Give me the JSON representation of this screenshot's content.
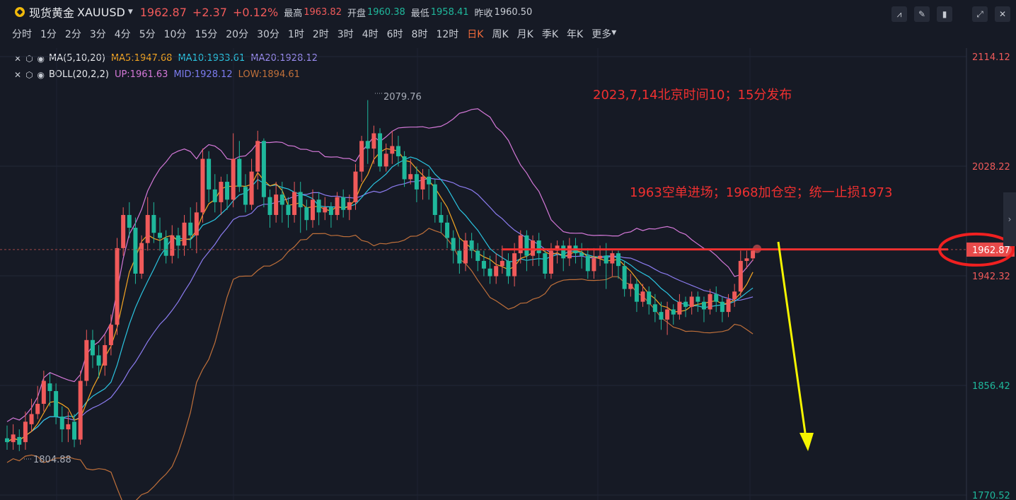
{
  "header": {
    "instrument": "现货黄金",
    "symbol": "XAUUSD",
    "last": "1962.87",
    "change": "+2.37",
    "change_pct": "+0.12%",
    "high_label": "最高",
    "high": "1963.82",
    "open_label": "开盘",
    "open": "1960.38",
    "low_label": "最低",
    "low": "1958.41",
    "prev_close_label": "昨收",
    "prev_close": "1960.50"
  },
  "periods": [
    "分时",
    "1分",
    "2分",
    "3分",
    "4分",
    "5分",
    "10分",
    "15分",
    "20分",
    "30分",
    "1时",
    "2时",
    "3时",
    "4时",
    "6时",
    "8时",
    "12时",
    "日K",
    "周K",
    "月K",
    "季K",
    "年K",
    "更多"
  ],
  "active_period": "日K",
  "indicators": {
    "ma": {
      "name": "MA(5,10,20)",
      "ma5": "MA5:1947.68",
      "ma10": "MA10:1933.61",
      "ma20": "MA20:1928.12"
    },
    "boll": {
      "name": "BOLL(20,2,2)",
      "up": "UP:1961.63",
      "mid": "MID:1928.12",
      "low": "LOW:1894.61"
    }
  },
  "annotations": {
    "note1": "2023,7,14北京时间10；15分发布",
    "note2": "1963空单进场；1968加仓空；统一止损1973",
    "max_label": "2079.76",
    "min_label": "1804.88"
  },
  "colors": {
    "up": "#f05a5a",
    "down": "#1fb89c",
    "ma5": "#f5a623",
    "ma10": "#2bc4e0",
    "ma20": "#8c7cf0",
    "boll_up": "#d478d8",
    "boll_low": "#c0703a",
    "annotation": "#f03030",
    "arrow": "#f5f500"
  },
  "chart_data": {
    "type": "candlestick",
    "y_axis_labels": [
      "2114.12",
      "2028.22",
      "1942.32",
      "1856.42",
      "1770.52"
    ],
    "ylim": [
      1770.52,
      2114.12
    ],
    "price_tag": "1962.87",
    "entry_level": 1963,
    "candles": [
      [
        1815,
        1812,
        1825,
        1806
      ],
      [
        1812,
        1818,
        1826,
        1806
      ],
      [
        1816,
        1810,
        1822,
        1805
      ],
      [
        1812,
        1828,
        1836,
        1806
      ],
      [
        1826,
        1834,
        1846,
        1820
      ],
      [
        1834,
        1842,
        1856,
        1830
      ],
      [
        1842,
        1860,
        1868,
        1836
      ],
      [
        1858,
        1852,
        1866,
        1840
      ],
      [
        1852,
        1832,
        1858,
        1826
      ],
      [
        1832,
        1822,
        1840,
        1812
      ],
      [
        1822,
        1826,
        1836,
        1812
      ],
      [
        1828,
        1814,
        1834,
        1808
      ],
      [
        1814,
        1860,
        1868,
        1810
      ],
      [
        1860,
        1892,
        1900,
        1856
      ],
      [
        1892,
        1880,
        1900,
        1870
      ],
      [
        1880,
        1872,
        1888,
        1862
      ],
      [
        1872,
        1888,
        1896,
        1864
      ],
      [
        1888,
        1904,
        1912,
        1880
      ],
      [
        1904,
        1964,
        1972,
        1896
      ],
      [
        1964,
        1990,
        1996,
        1958
      ],
      [
        1990,
        1980,
        2000,
        1972
      ],
      [
        1980,
        1944,
        1988,
        1936
      ],
      [
        1944,
        1968,
        1974,
        1940
      ],
      [
        1968,
        1990,
        2004,
        1962
      ],
      [
        1990,
        1976,
        2000,
        1968
      ],
      [
        1976,
        1972,
        1988,
        1962
      ],
      [
        1972,
        1958,
        1978,
        1952
      ],
      [
        1958,
        1974,
        1982,
        1952
      ],
      [
        1974,
        1966,
        1980,
        1956
      ],
      [
        1966,
        1984,
        1990,
        1958
      ],
      [
        1984,
        1974,
        1996,
        1964
      ],
      [
        1974,
        1992,
        2000,
        1960
      ],
      [
        1992,
        2034,
        2042,
        1984
      ],
      [
        2034,
        2010,
        2040,
        2000
      ],
      [
        2010,
        2000,
        2022,
        1992
      ],
      [
        2000,
        2016,
        2020,
        1990
      ],
      [
        2016,
        2002,
        2022,
        1994
      ],
      [
        2002,
        2034,
        2054,
        1996
      ],
      [
        2034,
        2012,
        2048,
        2008
      ],
      [
        2012,
        1998,
        2022,
        1992
      ],
      [
        1998,
        2024,
        2034,
        1994
      ],
      [
        2024,
        2048,
        2056,
        2010
      ],
      [
        2048,
        2004,
        2050,
        1996
      ],
      [
        2004,
        1990,
        2010,
        1980
      ],
      [
        1990,
        2006,
        2016,
        1984
      ],
      [
        2006,
        1998,
        2016,
        1984
      ],
      [
        1998,
        1990,
        2004,
        1980
      ],
      [
        1990,
        2008,
        2016,
        1984
      ],
      [
        2008,
        1996,
        2016,
        1976
      ],
      [
        1996,
        1986,
        2002,
        1978
      ],
      [
        1986,
        2002,
        2010,
        1980
      ],
      [
        2002,
        1992,
        2008,
        1982
      ],
      [
        1992,
        1996,
        2004,
        1986
      ],
      [
        1996,
        1990,
        2000,
        1980
      ],
      [
        1990,
        2004,
        2008,
        1986
      ],
      [
        2004,
        1994,
        2010,
        1988
      ],
      [
        1994,
        2000,
        2006,
        1986
      ],
      [
        2000,
        2024,
        2030,
        1994
      ],
      [
        2024,
        2048,
        2052,
        2016
      ],
      [
        2048,
        2042,
        2080,
        2030
      ],
      [
        2042,
        2054,
        2060,
        2030
      ],
      [
        2054,
        2028,
        2058,
        2024
      ],
      [
        2028,
        2038,
        2046,
        2024
      ],
      [
        2038,
        2044,
        2056,
        2030
      ],
      [
        2044,
        2036,
        2052,
        2028
      ],
      [
        2036,
        2018,
        2040,
        2012
      ],
      [
        2018,
        2022,
        2034,
        2014
      ],
      [
        2022,
        2010,
        2028,
        2000
      ],
      [
        2010,
        2020,
        2026,
        2002
      ],
      [
        2020,
        2014,
        2026,
        2002
      ],
      [
        2014,
        1990,
        2018,
        1984
      ],
      [
        1990,
        1984,
        2000,
        1976
      ],
      [
        1984,
        1972,
        1990,
        1964
      ],
      [
        1972,
        1962,
        1978,
        1952
      ],
      [
        1962,
        1952,
        1972,
        1944
      ],
      [
        1952,
        1970,
        1976,
        1946
      ],
      [
        1970,
        1962,
        1976,
        1956
      ],
      [
        1962,
        1954,
        1968,
        1946
      ],
      [
        1954,
        1948,
        1962,
        1942
      ],
      [
        1948,
        1942,
        1958,
        1936
      ],
      [
        1942,
        1950,
        1960,
        1936
      ],
      [
        1950,
        1954,
        1966,
        1944
      ],
      [
        1954,
        1942,
        1960,
        1936
      ],
      [
        1942,
        1960,
        1968,
        1934
      ],
      [
        1960,
        1974,
        1978,
        1952
      ],
      [
        1974,
        1958,
        1978,
        1946
      ],
      [
        1958,
        1970,
        1974,
        1950
      ],
      [
        1970,
        1960,
        1976,
        1950
      ],
      [
        1960,
        1944,
        1964,
        1940
      ],
      [
        1944,
        1962,
        1968,
        1940
      ],
      [
        1962,
        1966,
        1970,
        1952
      ],
      [
        1966,
        1956,
        1970,
        1946
      ],
      [
        1956,
        1966,
        1972,
        1950
      ],
      [
        1966,
        1960,
        1972,
        1952
      ],
      [
        1960,
        1958,
        1968,
        1948
      ],
      [
        1958,
        1946,
        1964,
        1940
      ],
      [
        1946,
        1956,
        1964,
        1940
      ],
      [
        1956,
        1958,
        1966,
        1950
      ],
      [
        1958,
        1952,
        1968,
        1932
      ],
      [
        1952,
        1960,
        1962,
        1942
      ],
      [
        1960,
        1950,
        1962,
        1940
      ],
      [
        1950,
        1932,
        1954,
        1926
      ],
      [
        1932,
        1936,
        1944,
        1926
      ],
      [
        1936,
        1922,
        1940,
        1914
      ],
      [
        1922,
        1930,
        1936,
        1918
      ],
      [
        1930,
        1920,
        1934,
        1912
      ],
      [
        1920,
        1914,
        1928,
        1906
      ],
      [
        1914,
        1908,
        1922,
        1900
      ],
      [
        1908,
        1916,
        1922,
        1896
      ],
      [
        1916,
        1912,
        1920,
        1904
      ],
      [
        1912,
        1922,
        1928,
        1908
      ],
      [
        1922,
        1918,
        1926,
        1910
      ],
      [
        1918,
        1926,
        1930,
        1912
      ],
      [
        1926,
        1922,
        1930,
        1914
      ],
      [
        1922,
        1916,
        1926,
        1906
      ],
      [
        1916,
        1928,
        1932,
        1912
      ],
      [
        1928,
        1922,
        1934,
        1914
      ],
      [
        1922,
        1914,
        1926,
        1906
      ],
      [
        1914,
        1924,
        1928,
        1910
      ],
      [
        1924,
        1930,
        1936,
        1918
      ],
      [
        1930,
        1954,
        1962,
        1926
      ],
      [
        1954,
        1956,
        1962,
        1948
      ],
      [
        1956,
        1962,
        1964,
        1954
      ]
    ]
  }
}
